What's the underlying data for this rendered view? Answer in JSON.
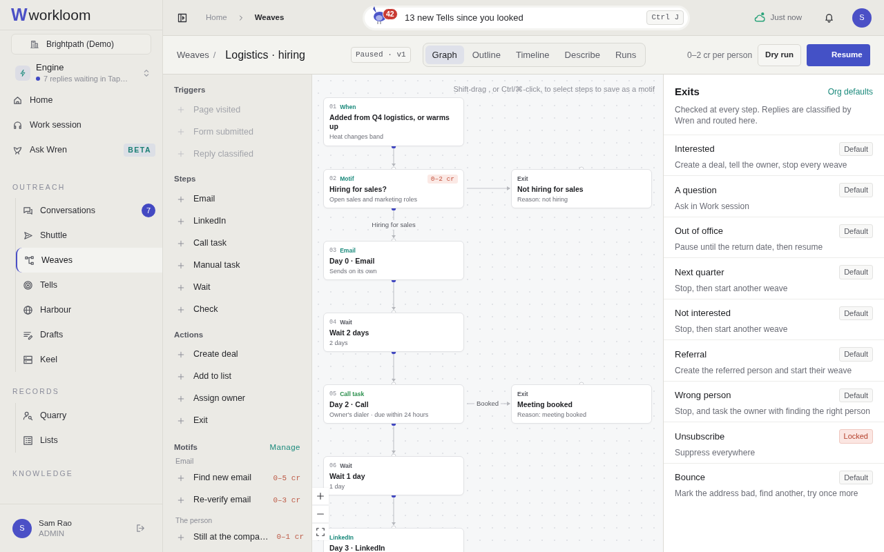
{
  "sidebar": {
    "logo_mark": "W",
    "brand": "workloom",
    "workspace": "Brightpath (Demo)",
    "engine": {
      "title": "Engine",
      "status": "7 replies waiting in Tap…"
    },
    "top_items": [
      {
        "label": "Home",
        "selected": false
      },
      {
        "label": "Work session",
        "selected": false
      },
      {
        "label": "Ask Wren",
        "badge": "BETA",
        "selected": false
      }
    ],
    "sections": [
      {
        "title": "OUTREACH",
        "items": [
          {
            "label": "Conversations",
            "count": "7",
            "selected": false
          },
          {
            "label": "Shuttle",
            "selected": false
          },
          {
            "label": "Weaves",
            "selected": true
          },
          {
            "label": "Tells",
            "selected": false
          },
          {
            "label": "Harbour",
            "selected": false
          },
          {
            "label": "Drafts",
            "selected": false
          },
          {
            "label": "Keel",
            "selected": false
          }
        ]
      },
      {
        "title": "RECORDS",
        "items": [
          {
            "label": "Quarry",
            "selected": false
          },
          {
            "label": "Lists",
            "selected": false
          }
        ]
      },
      {
        "title": "KNOWLEDGE"
      }
    ],
    "user": {
      "initial": "S",
      "name": "Sam Rao",
      "role": "ADMIN"
    }
  },
  "topbar": {
    "breadcrumb": [
      "Home",
      "Weaves"
    ],
    "notice": {
      "count": "42",
      "text": "13 new Tells since you looked",
      "shortcut": "Ctrl J"
    },
    "sync": "Just now",
    "avatar": "S"
  },
  "header": {
    "parent": "Weaves",
    "separator": "/",
    "title": "Logistics · hiring",
    "status": "Paused · v1",
    "tabs": [
      {
        "label": "Graph",
        "selected": true
      },
      {
        "label": "Outline",
        "selected": false
      },
      {
        "label": "Timeline",
        "selected": false
      },
      {
        "label": "Describe",
        "selected": false
      },
      {
        "label": "Runs",
        "selected": false
      }
    ],
    "cost": "0–2 cr per person",
    "dry_run": "Dry run",
    "resume": "Resume"
  },
  "palette": {
    "groups": [
      {
        "title": "Triggers",
        "items": [
          {
            "label": "Page visited",
            "disabled": true
          },
          {
            "label": "Form submitted",
            "disabled": true
          },
          {
            "label": "Reply classified",
            "disabled": true
          }
        ]
      },
      {
        "title": "Steps",
        "items": [
          {
            "label": "Email",
            "disabled": false
          },
          {
            "label": "LinkedIn",
            "disabled": false
          },
          {
            "label": "Call task",
            "disabled": false
          },
          {
            "label": "Manual task",
            "disabled": false
          },
          {
            "label": "Wait",
            "disabled": false
          },
          {
            "label": "Check",
            "disabled": false
          }
        ]
      },
      {
        "title": "Actions",
        "items": [
          {
            "label": "Create deal",
            "disabled": false
          },
          {
            "label": "Add to list",
            "disabled": false
          },
          {
            "label": "Assign owner",
            "disabled": false
          },
          {
            "label": "Exit",
            "disabled": false
          }
        ]
      },
      {
        "title": "Motifs",
        "action": "Manage",
        "subgroups": [
          {
            "title": "Email",
            "items": [
              {
                "label": "Find new email",
                "cost": "0–5 cr",
                "disabled": false
              },
              {
                "label": "Re-verify email",
                "cost": "0–3 cr",
                "disabled": false
              }
            ]
          },
          {
            "title": "The person",
            "items": [
              {
                "label": "Still at the compa…",
                "cost": "0–1 cr",
                "disabled": false
              }
            ]
          }
        ]
      }
    ]
  },
  "canvas": {
    "hint": "Shift-drag , or Ctrl/⌘-click, to select steps to save as a motif",
    "steps": [
      {
        "num": "01",
        "kind": "trigger",
        "type": "When",
        "title": "Added from Q4 logistics, or warms up",
        "sub": "Heat changes band"
      },
      {
        "num": "02",
        "kind": "motif",
        "type": "Motif",
        "cost": "0–2 cr",
        "title": "Hiring for sales?",
        "sub": "Open sales and marketing roles",
        "next_label": "Hiring for sales",
        "branch": {
          "type": "Exit",
          "title": "Not hiring for sales",
          "sub": "Reason: not hiring"
        }
      },
      {
        "num": "03",
        "kind": "email",
        "type": "Email",
        "title": "Day 0 · Email",
        "sub": "Sends on its own"
      },
      {
        "num": "04",
        "kind": "wait",
        "type": "Wait",
        "title": "Wait 2 days",
        "sub": "2 days"
      },
      {
        "num": "05",
        "kind": "call",
        "type": "Call task",
        "title": "Day 2 · Call",
        "sub": "Owner's dialer · due within 24 hours",
        "branch": {
          "label": "Booked",
          "type": "Exit",
          "title": "Meeting booked",
          "sub": "Reason: meeting booked"
        }
      },
      {
        "num": "06",
        "kind": "wait",
        "type": "Wait",
        "title": "Wait 1 day",
        "sub": "1 day"
      },
      {
        "kind": "linkedin",
        "type": "LinkedIn",
        "title": "Day 3 · LinkedIn"
      }
    ]
  },
  "exits": {
    "title": "Exits",
    "action": "Org defaults",
    "description": "Checked at every step. Replies are classified by Wren and routed here.",
    "items": [
      {
        "title": "Interested",
        "desc": "Create a deal, tell the owner, stop every weave",
        "badge": "Default",
        "kind": "default"
      },
      {
        "title": "A question",
        "desc": "Ask in Work session",
        "badge": "Default",
        "kind": "default"
      },
      {
        "title": "Out of office",
        "desc": "Pause until the return date, then resume",
        "badge": "Default",
        "kind": "default"
      },
      {
        "title": "Next quarter",
        "desc": "Stop, then start another weave",
        "badge": "Default",
        "kind": "default"
      },
      {
        "title": "Not interested",
        "desc": "Stop, then start another weave",
        "badge": "Default",
        "kind": "default"
      },
      {
        "title": "Referral",
        "desc": "Create the referred person and start their weave",
        "badge": "Default",
        "kind": "default"
      },
      {
        "title": "Wrong person",
        "desc": "Stop, and task the owner with finding the right person",
        "badge": "Default",
        "kind": "default"
      },
      {
        "title": "Unsubscribe",
        "desc": "Suppress everywhere",
        "badge": "Locked",
        "kind": "locked"
      },
      {
        "title": "Bounce",
        "desc": "Mark the address bad, find another, try once more",
        "badge": "Default",
        "kind": "default"
      }
    ]
  }
}
